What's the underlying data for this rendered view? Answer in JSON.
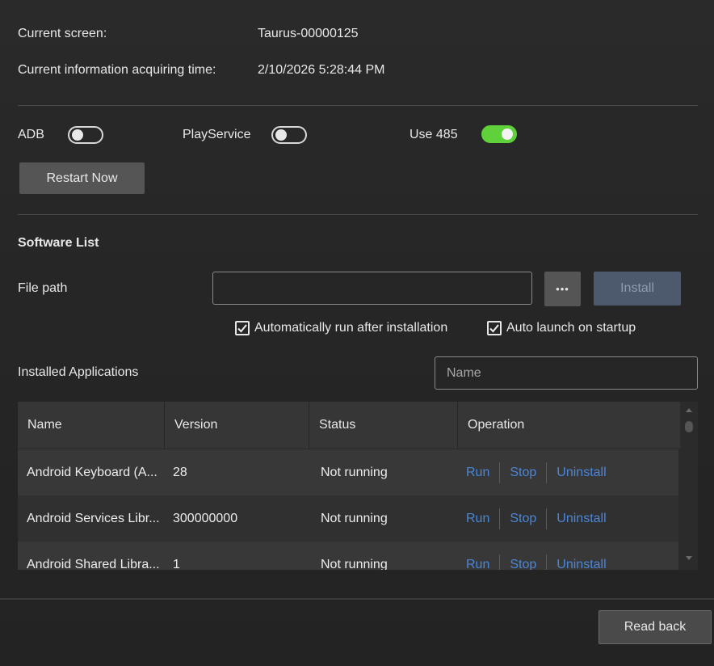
{
  "info": {
    "screen_label": "Current screen:",
    "screen_value": "Taurus-00000125",
    "time_label": "Current information acquiring time:",
    "time_value": "2/10/2026 5:28:44 PM"
  },
  "toggles": [
    {
      "label": "ADB",
      "on": false
    },
    {
      "label": "PlayService",
      "on": false
    },
    {
      "label": "Use 485",
      "on": true
    }
  ],
  "restart_label": "Restart Now",
  "software": {
    "title": "Software List",
    "file_path_label": "File path",
    "file_path_value": "",
    "browse_label": "•••",
    "install_label": "Install",
    "auto_run_label": "Automatically run after installation",
    "auto_run_checked": true,
    "auto_launch_label": "Auto launch on startup",
    "auto_launch_checked": true
  },
  "installed": {
    "title": "Installed Applications",
    "search_placeholder": "Name",
    "columns": [
      "Name",
      "Version",
      "Status",
      "Operation"
    ],
    "rows": [
      {
        "name": "Android Keyboard (A...",
        "version": "28",
        "status": "Not running"
      },
      {
        "name": "Android Services Libr...",
        "version": "300000000",
        "status": "Not running"
      },
      {
        "name": "Android Shared Libra...",
        "version": "1",
        "status": "Not running"
      }
    ],
    "ops": {
      "run": "Run",
      "stop": "Stop",
      "uninstall": "Uninstall"
    }
  },
  "read_back_label": "Read back",
  "colors": {
    "accent_on": "#5fd13a",
    "link": "#4b86d6",
    "install_button": "#4d5a6e"
  }
}
